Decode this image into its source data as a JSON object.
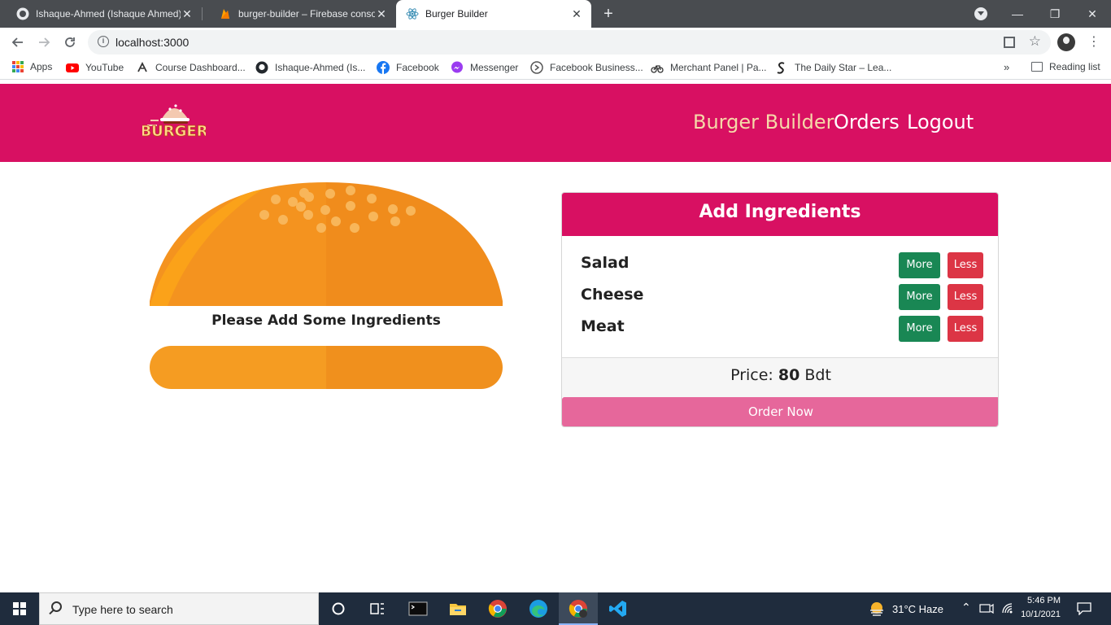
{
  "browser": {
    "tabs": [
      {
        "title": "Ishaque-Ahmed (Ishaque Ahmed)",
        "icon": "github-icon",
        "close": "✕"
      },
      {
        "title": "burger-builder – Firebase console",
        "icon": "firebase-icon",
        "close": "✕"
      },
      {
        "title": "Burger Builder",
        "icon": "react-icon",
        "close": "✕",
        "active": true
      }
    ],
    "new_tab": "+",
    "window_controls": {
      "minimize": "—",
      "restore": "❐",
      "close": "✕"
    },
    "url": "localhost:3000",
    "bookmarks": [
      {
        "label": "Apps",
        "icon": "apps-grid-icon"
      },
      {
        "label": "YouTube",
        "icon": "youtube-icon",
        "color": "#ff0000"
      },
      {
        "label": "Course Dashboard...",
        "icon": "course-icon"
      },
      {
        "label": "Ishaque-Ahmed (Is...",
        "icon": "github-icon"
      },
      {
        "label": "Facebook",
        "icon": "facebook-icon",
        "color": "#1877f2"
      },
      {
        "label": "Messenger",
        "icon": "messenger-icon",
        "color": "#a033ff"
      },
      {
        "label": "Facebook Business...",
        "icon": "meta-business-icon"
      },
      {
        "label": "Merchant Panel | Pa...",
        "icon": "bicycle-icon"
      },
      {
        "label": "The Daily Star – Lea...",
        "icon": "daily-star-icon"
      }
    ],
    "more_bookmarks": "»",
    "reading_list": "Reading list"
  },
  "app": {
    "brand_color": "#d81062",
    "logo_alt": "BURGER",
    "nav": [
      {
        "label": "Burger Builder",
        "active": true
      },
      {
        "label": "Orders",
        "active": false
      },
      {
        "label": "Logout",
        "active": false
      }
    ],
    "burger_message": "Please Add Some Ingredients",
    "controls": {
      "title": "Add Ingredients",
      "ingredients": [
        {
          "label": "Salad",
          "more": "More",
          "less": "Less"
        },
        {
          "label": "Cheese",
          "more": "More",
          "less": "Less"
        },
        {
          "label": "Meat",
          "more": "More",
          "less": "Less"
        }
      ],
      "price_label": "Price: ",
      "price_value": "80",
      "price_currency": " Bdt",
      "order_button": "Order Now"
    }
  },
  "taskbar": {
    "search_placeholder": "Type here to search",
    "weather": "31°C  Haze",
    "time": "5:46 PM",
    "date": "10/1/2021"
  }
}
